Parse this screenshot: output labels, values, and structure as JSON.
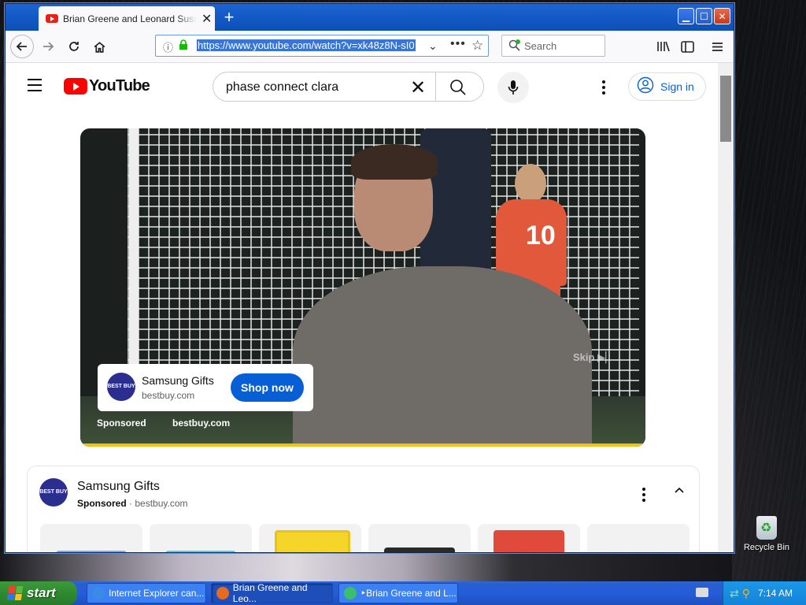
{
  "browser": {
    "tab_title": "Brian Greene and Leonard Susskind",
    "new_tab": "+",
    "url": "https://www.youtube.com/watch?v=xk48z8N-sI0",
    "search_placeholder": "Search",
    "window_buttons": [
      "minimize",
      "maximize",
      "close"
    ]
  },
  "youtube": {
    "logo_text": "YouTube",
    "search_query": "phase connect clara",
    "signin_label": "Sign in"
  },
  "video_ad": {
    "skip_label": "Skip",
    "advertiser": "Samsung Gifts",
    "domain": "bestbuy.com",
    "cta": "Shop now",
    "sponsored_label": "Sponsored",
    "overlay_domain": "bestbuy.com",
    "jersey_number": "10",
    "logo_text": "BEST BUY"
  },
  "ad_panel": {
    "advertiser": "Samsung Gifts",
    "sponsored_label": "Sponsored",
    "separator": "·",
    "domain": "bestbuy.com",
    "logo_text": "BEST BUY"
  },
  "taskbar": {
    "start_label": "start",
    "items": [
      {
        "label": "Internet Explorer can...",
        "active": false
      },
      {
        "label": "Brian Greene and Leo...",
        "active": true
      },
      {
        "label": "‣Brian Greene and L...",
        "active": false
      }
    ],
    "clock": "7:14 AM"
  },
  "desktop": {
    "recycle_bin_label": "Recycle Bin"
  }
}
